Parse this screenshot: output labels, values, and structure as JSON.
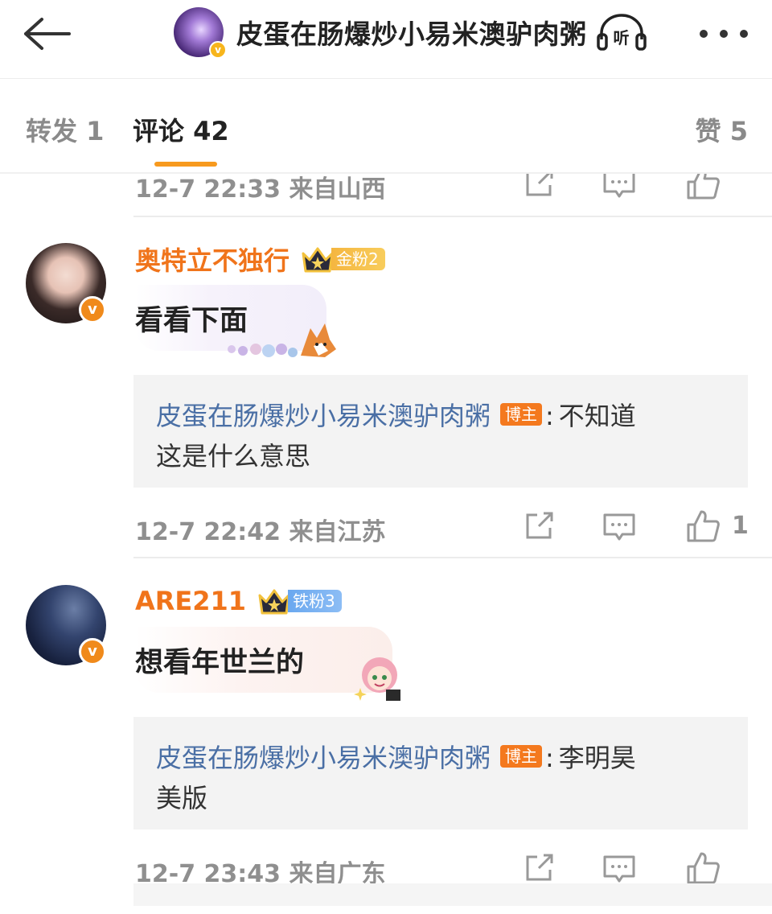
{
  "header": {
    "title": "皮蛋在肠爆炒小易米澳驴肉粥",
    "listen_label": "听",
    "back_icon": "arrow-left-icon",
    "more_icon": "more-dots-icon"
  },
  "tabs": {
    "repost": "转发 1",
    "comments": "评论 42",
    "likes": "赞 5"
  },
  "comments": [
    {
      "meta": {
        "time": "12-7 22:33",
        "location": "来自山西",
        "likes": ""
      }
    },
    {
      "username": "奥特立不独行",
      "fan_badge": "金粉2",
      "text": "看看下面",
      "reply": {
        "author": "皮蛋在肠爆炒小易米澳驴肉粥",
        "role": "博主",
        "line1": "不知道",
        "line2": "这是什么意思"
      },
      "meta": {
        "time": "12-7 22:42",
        "location": "来自江苏",
        "likes": "1"
      }
    },
    {
      "username": "ARE211",
      "fan_badge": "铁粉3",
      "text": "想看年世兰的",
      "reply": {
        "author": "皮蛋在肠爆炒小易米澳驴肉粥",
        "role": "博主",
        "line1": "李明昊",
        "line2": "美版"
      },
      "meta": {
        "time": "12-7 23:43",
        "location": "来自广东",
        "likes": ""
      }
    }
  ],
  "colors": {
    "username": "#f0741b",
    "reply_author": "#4a6fa5",
    "tab_accent": "#f79a1e",
    "host_badge": "#f4791e"
  },
  "icons": {
    "share": "share-icon",
    "reply": "comment-icon",
    "like": "thumbs-up-icon"
  }
}
